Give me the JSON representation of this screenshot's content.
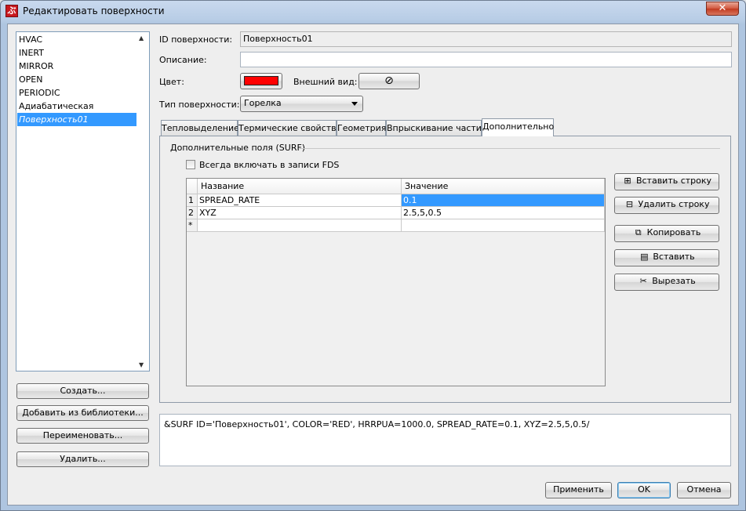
{
  "window": {
    "title": "Редактировать поверхности",
    "app_icon_glyph": "ぶ",
    "close_glyph": "✕"
  },
  "surfaces": {
    "items": [
      "HVAC",
      "INERT",
      "MIRROR",
      "OPEN",
      "PERIODIC",
      "Адиабатическая",
      "Поверхность01"
    ],
    "selected": "Поверхность01"
  },
  "left_buttons": {
    "create": "Создать...",
    "add_from_library": "Добавить из библиотеки...",
    "rename": "Переименовать...",
    "delete": "Удалить..."
  },
  "form": {
    "id_label": "ID поверхности:",
    "id_value": "Поверхность01",
    "description_label": "Описание:",
    "description_value": "",
    "color_label": "Цвет:",
    "color_value": "#ff0000",
    "appearance_label": "Внешний вид:",
    "appearance_icon": "no-texture-icon",
    "type_label": "Тип поверхности:",
    "type_value": "Горелка"
  },
  "tabs": [
    {
      "label": "Тепловыделение",
      "active": false
    },
    {
      "label": "Термические свойства",
      "active": false
    },
    {
      "label": "Геометрия",
      "active": false
    },
    {
      "label": "Впрыскивание частиц",
      "active": false
    },
    {
      "label": "Дополнительно",
      "active": true
    }
  ],
  "extra": {
    "group_title": "Дополнительные поля (SURF)",
    "always_include_label": "Всегда включать в записи FDS",
    "always_include_checked": false,
    "columns": [
      "Название",
      "Значение"
    ],
    "rows": [
      {
        "num": "1",
        "name": "SPREAD_RATE",
        "value": "0.1"
      },
      {
        "num": "2",
        "name": "XYZ",
        "value": "2.5,5,0.5"
      },
      {
        "num": "*",
        "name": "",
        "value": ""
      }
    ],
    "buttons": {
      "insert_row": "Вставить строку",
      "delete_row": "Удалить строку",
      "copy": "Копировать",
      "paste": "Вставить",
      "cut": "Вырезать"
    }
  },
  "preview_text": "&SURF ID='Поверхность01', COLOR='RED', HRRPUA=1000.0, SPREAD_RATE=0.1, XYZ=2.5,5,0.5/",
  "footer": {
    "apply": "Применить",
    "ok": "OK",
    "cancel": "Отмена"
  }
}
